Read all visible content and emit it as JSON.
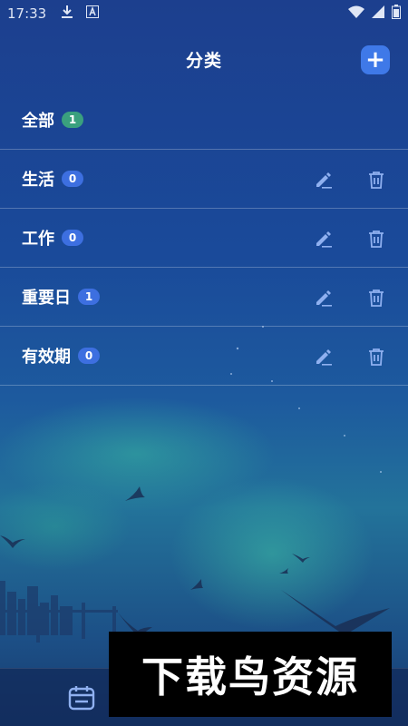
{
  "status_bar": {
    "time": "17:33",
    "left_icons": [
      "download-icon",
      "a-icon"
    ],
    "right_icons": [
      "wifi-icon",
      "signal-icon",
      "battery-icon"
    ]
  },
  "header": {
    "title": "分类",
    "add_button": "+"
  },
  "categories": [
    {
      "name": "全部",
      "count": "1",
      "badge_color": "#3aa07e",
      "editable": false
    },
    {
      "name": "生活",
      "count": "0",
      "badge_color": "#3d6fe0",
      "editable": true
    },
    {
      "name": "工作",
      "count": "0",
      "badge_color": "#3d6fe0",
      "editable": true
    },
    {
      "name": "重要日",
      "count": "1",
      "badge_color": "#3d6fe0",
      "editable": true
    },
    {
      "name": "有效期",
      "count": "0",
      "badge_color": "#3d6fe0",
      "editable": true
    }
  ],
  "bottom_bar": {
    "icons": [
      "calendar-icon"
    ]
  },
  "watermark": {
    "text": "下载鸟资源"
  },
  "colors": {
    "accent": "#3f79e8",
    "badge_green": "#3aa07e",
    "badge_blue": "#3d6fe0",
    "icon_edit": "#8fb0f0",
    "icon_delete": "#8fb0f0"
  }
}
